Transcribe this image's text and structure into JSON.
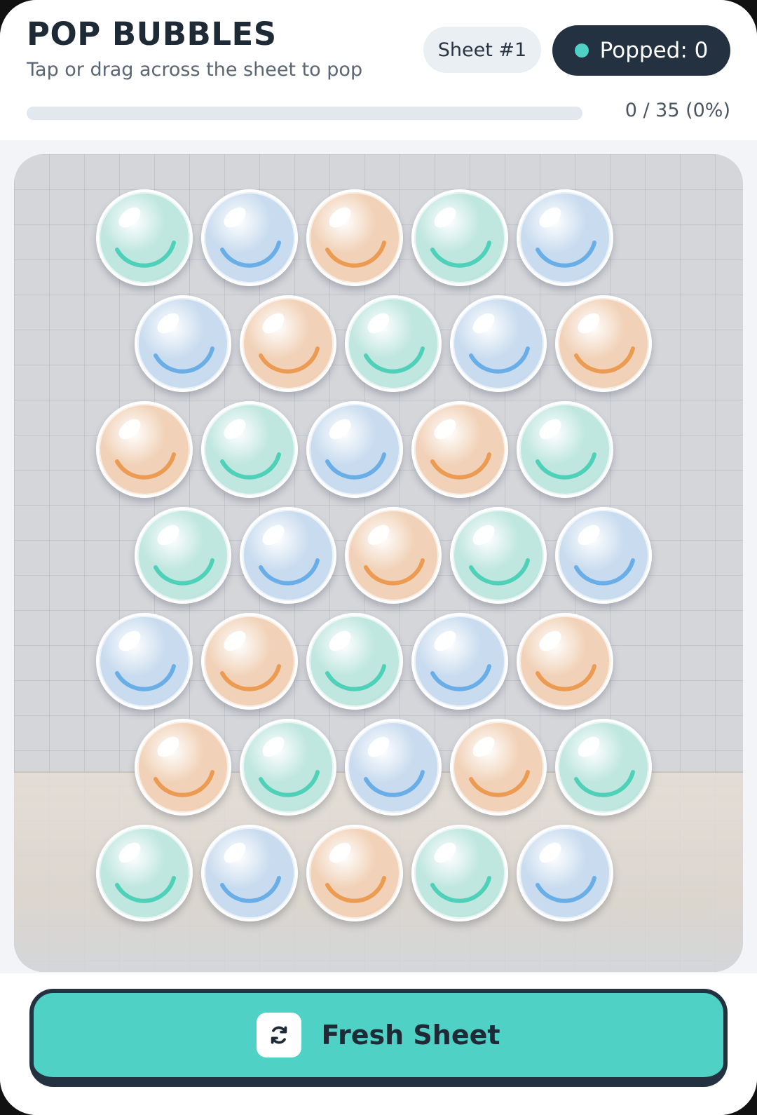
{
  "header": {
    "title": "POP BUBBLES",
    "subtitle": "Tap or drag across the sheet to pop",
    "sheet_label": "Sheet #1",
    "popped_label": "Popped: 0"
  },
  "progress": {
    "text": "0 / 35 (0%)",
    "popped": 0,
    "total": 35
  },
  "board": {
    "rows": [
      [
        "teal",
        "blue",
        "orange",
        "teal",
        "blue"
      ],
      [
        "blue",
        "orange",
        "teal",
        "blue",
        "orange"
      ],
      [
        "orange",
        "teal",
        "blue",
        "orange",
        "teal"
      ],
      [
        "teal",
        "blue",
        "orange",
        "teal",
        "blue"
      ],
      [
        "blue",
        "orange",
        "teal",
        "blue",
        "orange"
      ],
      [
        "orange",
        "teal",
        "blue",
        "orange",
        "teal"
      ],
      [
        "teal",
        "blue",
        "orange",
        "teal",
        "blue"
      ]
    ]
  },
  "colors": {
    "teal": {
      "fill": "#bfe6df",
      "edge": "#8fd3c7",
      "arc": "#4fd1b9"
    },
    "blue": {
      "fill": "#c9dcef",
      "edge": "#a3c3e6",
      "arc": "#6aaee8"
    },
    "orange": {
      "fill": "#f1d2b8",
      "edge": "#e8b48a",
      "arc": "#ec9b52"
    },
    "accent": "#4fd1c5",
    "dark": "#243140"
  },
  "footer": {
    "button_label": "Fresh Sheet",
    "button_icon": "refresh-icon"
  }
}
